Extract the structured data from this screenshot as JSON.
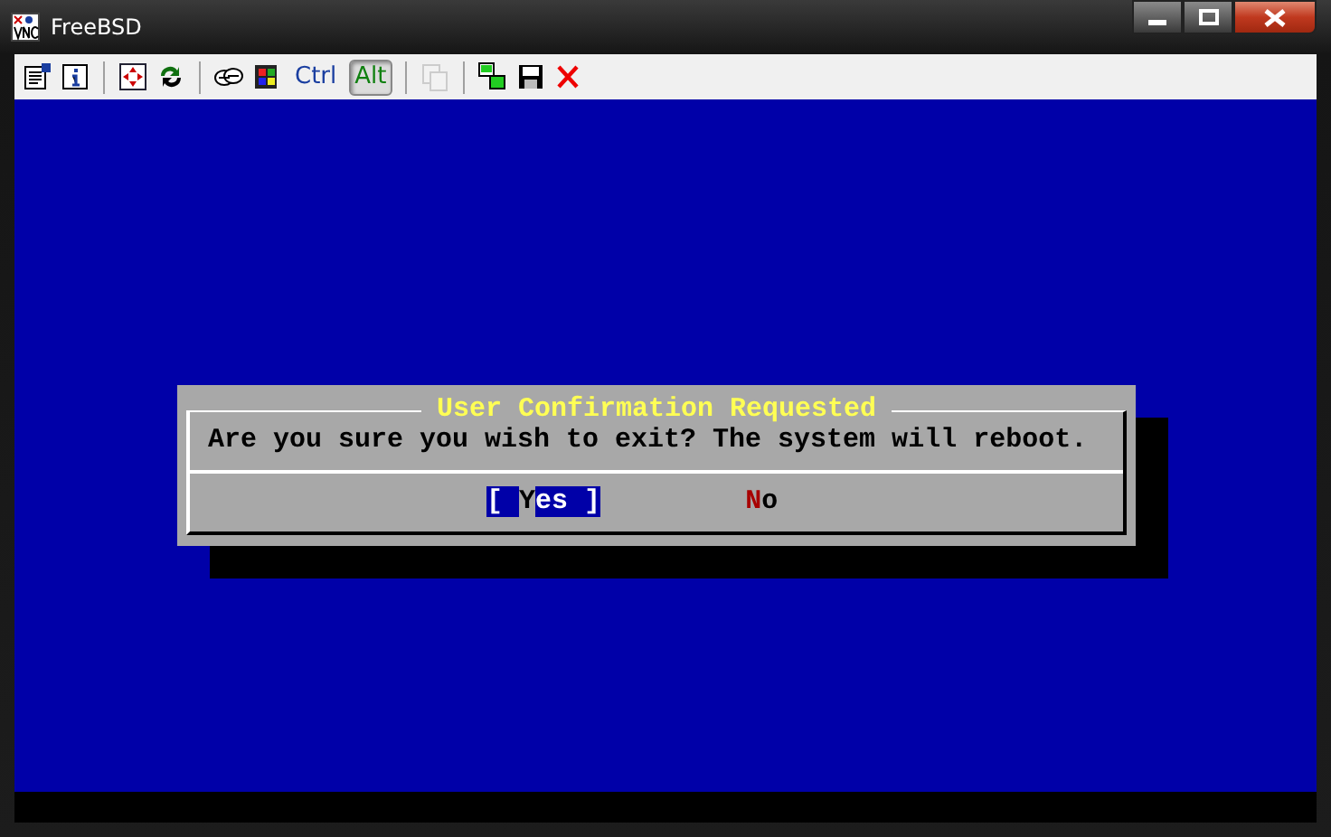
{
  "window": {
    "title": "FreeBSD"
  },
  "toolbar": [
    {
      "kind": "icon"
    },
    {
      "kind": "icon"
    },
    {
      "kind": "separator"
    },
    {
      "kind": "icon"
    },
    {
      "kind": "icon"
    },
    {
      "kind": "separator"
    },
    {
      "kind": "icon"
    },
    {
      "kind": "icon"
    },
    {
      "kind": "key",
      "label": "Ctrl",
      "on": false
    },
    {
      "kind": "key",
      "label": "Alt",
      "on": true
    },
    {
      "kind": "separator"
    },
    {
      "kind": "icon",
      "disabled": true
    },
    {
      "kind": "separator"
    },
    {
      "kind": "icon"
    },
    {
      "kind": "icon"
    },
    {
      "kind": "icon"
    }
  ],
  "dialog": {
    "title": "User Confirmation Requested",
    "message": "Are you sure you wish to exit? The system will reboot.",
    "buttons": [
      {
        "open": "[ ",
        "hotkey": "Y",
        "rest": "es",
        "close": " ]",
        "selected": true
      },
      {
        "hotkey": "N",
        "rest": "o",
        "selected": false
      }
    ]
  }
}
